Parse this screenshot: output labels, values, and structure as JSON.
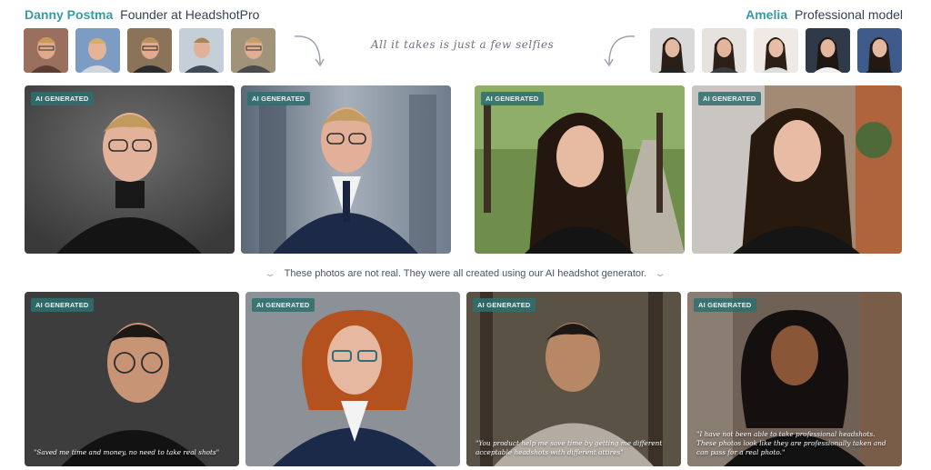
{
  "header": {
    "left": {
      "name": "Danny Postma",
      "role": "Founder at HeadshotPro"
    },
    "right": {
      "name": "Amelia",
      "role": "Professional model"
    },
    "tagline": "All it takes is just a few selfies"
  },
  "badge_label": "AI GENERATED",
  "notice": "These photos are not real. They were all created using our AI headshot generator.",
  "quotes": {
    "q1": "\"Saved me time and money, no need to take real shots\"",
    "q3": "\"You product help me save time by getting me different acceptable headshots with different attires\"",
    "q4": "\"I have not been able to take professional headshots. These photos look like they are professionally taken and can pass for a real photo.\""
  },
  "colors": {
    "accent": "#3a9aa3",
    "badge": "#2e6e6e"
  },
  "icons": [
    "curved-arrow-icon",
    "chevron-down-icon"
  ]
}
